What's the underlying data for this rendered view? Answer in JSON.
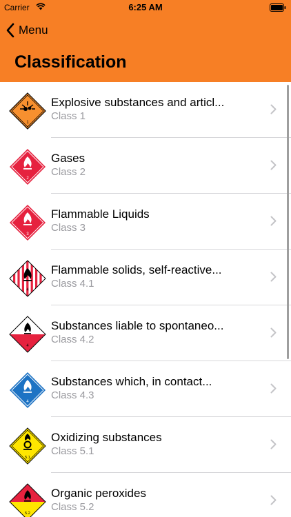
{
  "status_bar": {
    "carrier": "Carrier",
    "time": "6:25 AM",
    "wifi_icon": "wifi-icon",
    "battery_icon": "battery-full-icon"
  },
  "nav": {
    "back_label": "Menu",
    "back_icon": "chevron-left-icon",
    "title": "Classification",
    "bar_color": "#f77f25"
  },
  "rows": [
    {
      "title": "Explosive substances and articl...",
      "subtitle": "Class 1",
      "icon": "explosive-placard-icon",
      "placard_color": "#f7902f",
      "placard_number": "1"
    },
    {
      "title": "Gases",
      "subtitle": "Class 2",
      "icon": "flammable-gas-placard-icon",
      "placard_color": "#e6223f",
      "placard_number": "2"
    },
    {
      "title": "Flammable Liquids",
      "subtitle": "Class 3",
      "icon": "flammable-liquid-placard-icon",
      "placard_color": "#e6223f",
      "placard_number": "3"
    },
    {
      "title": "Flammable solids, self-reactive...",
      "subtitle": "Class 4.1",
      "icon": "flammable-solid-placard-icon",
      "placard_color": "#e6223f",
      "placard_number": "4"
    },
    {
      "title": "Substances liable to spontaneo...",
      "subtitle": "Class 4.2",
      "icon": "spontaneous-combustion-placard-icon",
      "placard_color": "#e6223f",
      "placard_number": "4"
    },
    {
      "title": "Substances which, in contact...",
      "subtitle": "Class 4.3",
      "icon": "dangerous-when-wet-placard-icon",
      "placard_color": "#1d73c4",
      "placard_number": "4"
    },
    {
      "title": "Oxidizing substances",
      "subtitle": "Class 5.1",
      "icon": "oxidizer-placard-icon",
      "placard_color": "#ffe600",
      "placard_number": "5.1"
    },
    {
      "title": "Organic peroxides",
      "subtitle": "Class 5.2",
      "icon": "organic-peroxide-placard-icon",
      "placard_color": "#e6223f",
      "placard_number": "5.2"
    }
  ],
  "row_chevron_icon": "chevron-right-icon",
  "scroll_indicator": "scroll-indicator"
}
